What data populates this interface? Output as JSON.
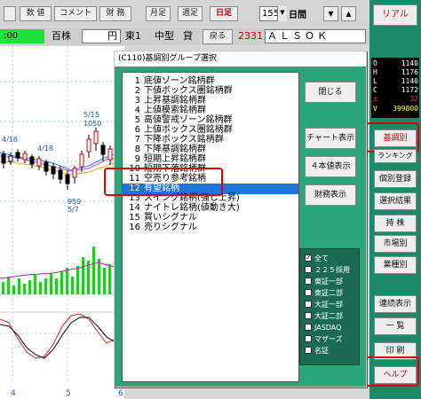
{
  "toolbar": {
    "buttons": [
      "数 値",
      "コメント",
      "財 務",
      "月足",
      "週足",
      "日足"
    ],
    "period_value": "155",
    "period_unit": "日間",
    "nav_down": "▼",
    "nav_up": "▲"
  },
  "stock": {
    "time": ":00",
    "unit": "百株",
    "currency": "円",
    "market": "東1",
    "size": "中型",
    "lending": "貸",
    "back_label": "戻る",
    "code": "2331",
    "name": "ＡＬＳＯＫ"
  },
  "chart": {
    "price_labels": [
      "5/15",
      "1050",
      "4/16",
      "4/18",
      "959",
      "5/7"
    ],
    "x_labels": [
      "4",
      "5",
      "6"
    ]
  },
  "right_panel": {
    "real_label": "リアル",
    "quote": [
      {
        "label": "O",
        "value": "1140",
        "color": "#ffffff"
      },
      {
        "label": "H",
        "value": "1176",
        "color": "#ffffff"
      },
      {
        "label": "L",
        "value": "1140",
        "color": "#ffffff"
      },
      {
        "label": "C",
        "value": "1172",
        "color": "#ffffff"
      },
      {
        "label": "±",
        "value": "32",
        "color": "#ff3030"
      },
      {
        "label": "V",
        "value": "399800",
        "color": "#ffff40"
      }
    ],
    "buttons": [
      "基調別",
      "ランキング",
      "個別登録",
      "選択結果",
      "持 株",
      "市場別",
      "業種別",
      "連続表示",
      "一 覧",
      "印 刷",
      "ヘルプ"
    ]
  },
  "dialog": {
    "title": "(C110)基調別グループ選択",
    "items": [
      {
        "num": "1",
        "label": "底値ゾーン銘柄群"
      },
      {
        "num": "2",
        "label": "下値ボックス圏銘柄群"
      },
      {
        "num": "3",
        "label": "上昇基調銘柄群"
      },
      {
        "num": "4",
        "label": "上値模索銘柄群"
      },
      {
        "num": "5",
        "label": "高値警戒ゾーン銘柄群"
      },
      {
        "num": "6",
        "label": "上値ボックス圏銘柄群"
      },
      {
        "num": "7",
        "label": "下降ボックス銘柄群"
      },
      {
        "num": "8",
        "label": "下降基調銘柄群"
      },
      {
        "num": "9",
        "label": "短期上昇銘柄群"
      },
      {
        "num": "10",
        "label": "短期下落銘柄群"
      },
      {
        "num": "11",
        "label": "空売り参考銘柄"
      },
      {
        "num": "12",
        "label": "有望銘柄"
      },
      {
        "num": "13",
        "label": "スイング銘柄(強し上昇)"
      },
      {
        "num": "14",
        "label": "ナイトレ銘柄(値動き大)"
      },
      {
        "num": "15",
        "label": "買いシグナル"
      },
      {
        "num": "16",
        "label": "売りシグナル"
      }
    ],
    "selected_index": 11,
    "buttons": [
      "閉じる",
      "チャート表示",
      "４本値表示",
      "財務表示"
    ],
    "checkboxes": [
      {
        "label": "全て",
        "checked": true
      },
      {
        "label": "２２５採用",
        "checked": false
      },
      {
        "label": "東証一部",
        "checked": false
      },
      {
        "label": "東証二部",
        "checked": false
      },
      {
        "label": "大証一部",
        "checked": false
      },
      {
        "label": "大証二部",
        "checked": false
      },
      {
        "label": "JASDAQ",
        "checked": false
      },
      {
        "label": "マザーズ",
        "checked": false
      },
      {
        "label": "名証",
        "checked": false
      }
    ]
  }
}
